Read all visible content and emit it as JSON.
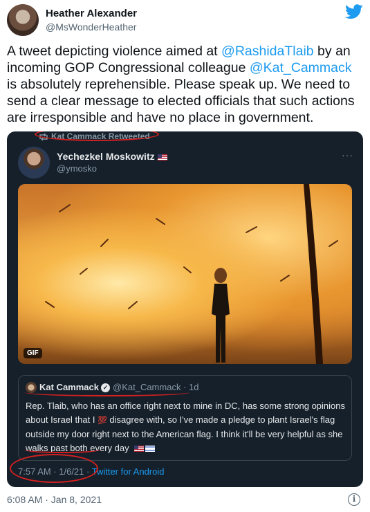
{
  "tweet": {
    "author_name": "Heather Alexander",
    "author_handle": "@MsWonderHeather",
    "text_segments": [
      {
        "text": "A tweet depicting violence aimed at ",
        "type": "text"
      },
      {
        "text": "@RashidaTlaib",
        "type": "mention"
      },
      {
        "text": " by an incoming GOP Congressional colleague ",
        "type": "text"
      },
      {
        "text": "@Kat_Cammack",
        "type": "mention"
      },
      {
        "text": " is absolutely reprehensible. Please speak up. We need to send a clear message to elected officials that such actions are irresponsible and have no place in government.",
        "type": "text"
      }
    ],
    "timestamp": "6:08 AM · Jan 8, 2021"
  },
  "embedded_screenshot": {
    "retweet_label": "Kat Cammack Retweeted",
    "author_name": "Yechezkel Moskowitz",
    "author_handle": "@ymosko",
    "more_label": "···",
    "media_badge": "GIF",
    "quote": {
      "author_name": "Kat Cammack",
      "author_handle": "@Kat_Cammack · 1d",
      "text_before_emoji": "Rep. Tlaib, who has an office right next to mine in DC, has some strong opinions about Israel that I ",
      "emoji": "💯",
      "text_after_emoji": " disagree with, so I've made a pledge to plant Israel's flag outside my door right next to the American flag. I think it'll be very helpful as she walks past both every day"
    },
    "footer_time": "7:57 AM · 1/6/21 · ",
    "footer_source": "Twitter for Android"
  },
  "icons": {
    "brand": "twitter-bird-icon",
    "info": "info-icon",
    "retweet": "retweet-icon",
    "verified": "verified-icon"
  },
  "colors": {
    "twitter_blue": "#1d9bf0",
    "dark_bg": "#15202b",
    "annotation_red": "#d42020"
  }
}
